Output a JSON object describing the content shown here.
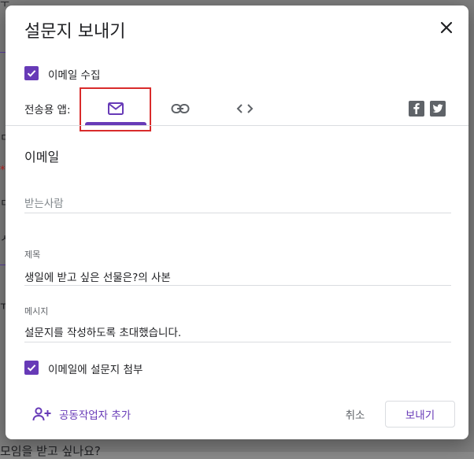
{
  "background": {
    "fragments": [
      "ㅜ",
      "ㄷ",
      "*",
      "ㄷ",
      "ㅅ",
      "ㅠ",
      "모임을 받고 싶나요?"
    ]
  },
  "dialog": {
    "title": "설문지 보내기",
    "collect_email": {
      "checked": true,
      "label": "이메일 수집"
    },
    "send_via": {
      "label": "전송용 앱:",
      "tabs": [
        {
          "name": "email",
          "icon": "mail-icon",
          "selected": true
        },
        {
          "name": "link",
          "icon": "link-icon",
          "selected": false
        },
        {
          "name": "embed",
          "icon": "code-icon",
          "selected": false
        }
      ],
      "social": [
        {
          "name": "facebook",
          "glyph": "f"
        },
        {
          "name": "twitter",
          "glyph": "t"
        }
      ]
    },
    "email_section": {
      "title": "이메일",
      "to": {
        "placeholder": "받는사람",
        "value": ""
      },
      "subject": {
        "label": "제목",
        "value": "생일에 받고 싶은 선물은?의 사본"
      },
      "message": {
        "label": "메시지",
        "value": "설문지를 작성하도록 초대했습니다."
      },
      "include_form": {
        "checked": true,
        "label": "이메일에 설문지 첨부"
      }
    },
    "footer": {
      "add_collaborators": "공동작업자 추가",
      "cancel": "취소",
      "send": "보내기"
    }
  },
  "colors": {
    "accent": "#673ab7",
    "highlight_box": "#d92b2b",
    "icon_gray": "#5f6368",
    "divider": "#dadce0"
  }
}
